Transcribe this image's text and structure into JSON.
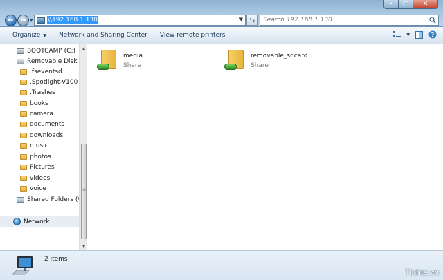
{
  "address": {
    "path": "\\\\192.168.1.130"
  },
  "search": {
    "placeholder": "Search 192.168.1.130"
  },
  "window_controls": {
    "minimize": "–",
    "maximize": "□",
    "close": "✕"
  },
  "toolbar": {
    "organize": "Organize",
    "network_sharing": "Network and Sharing Center",
    "remote_printers": "View remote printers"
  },
  "nav": {
    "items": [
      {
        "label": "BOOTCAMP (C:)",
        "icon": "drive-icon"
      },
      {
        "label": "Removable Disk (E:)",
        "icon": "drive-icon"
      },
      {
        "label": ".fseventsd",
        "icon": "folder-icon"
      },
      {
        "label": ".Spotlight-V100",
        "icon": "folder-icon"
      },
      {
        "label": ".Trashes",
        "icon": "folder-icon"
      },
      {
        "label": "books",
        "icon": "folder-icon"
      },
      {
        "label": "camera",
        "icon": "folder-icon"
      },
      {
        "label": "documents",
        "icon": "folder-icon"
      },
      {
        "label": "downloads",
        "icon": "folder-icon"
      },
      {
        "label": "music",
        "icon": "folder-icon"
      },
      {
        "label": "photos",
        "icon": "folder-icon"
      },
      {
        "label": "Pictures",
        "icon": "folder-icon"
      },
      {
        "label": "videos",
        "icon": "folder-icon"
      },
      {
        "label": "voice",
        "icon": "folder-icon"
      },
      {
        "label": "Shared Folders (\\\\vm",
        "icon": "share-icon"
      }
    ],
    "network": "Network"
  },
  "content": {
    "items": [
      {
        "name": "media",
        "type": "Share"
      },
      {
        "name": "removable_sdcard",
        "type": "Share"
      }
    ]
  },
  "details": {
    "count": "2 items"
  },
  "watermark": "Tinhte.vn"
}
